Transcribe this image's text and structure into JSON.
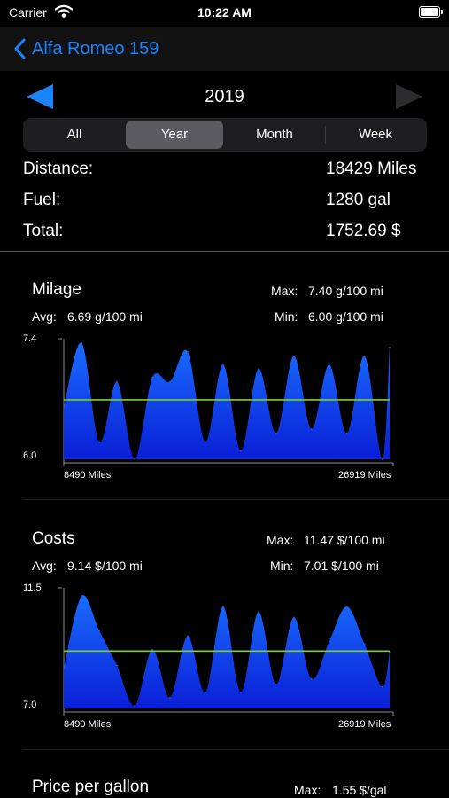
{
  "status_bar": {
    "carrier": "Carrier",
    "time": "10:22 AM"
  },
  "nav": {
    "back_label": "Alfa Romeo 159"
  },
  "year": "2019",
  "segments": {
    "all": "All",
    "year": "Year",
    "month": "Month",
    "week": "Week",
    "selected": "Year"
  },
  "summary": [
    {
      "label": "Distance:",
      "value": "18429 Miles"
    },
    {
      "label": "Fuel:",
      "value": "1280 gal"
    },
    {
      "label": "Total:",
      "value": "1752.69 $"
    }
  ],
  "colors": {
    "accent": "#1a84ff",
    "fill_top": "#1a6cff",
    "fill_bottom": "#0a1fd6",
    "avg_line": "#7fd12a"
  },
  "icons": {
    "back": "chevron-left-icon",
    "prev": "triangle-left-icon",
    "next": "triangle-right-icon"
  },
  "milage": {
    "title": "Milage",
    "max_label": "Max:",
    "max_value": "7.40 g/100 mi",
    "avg_label": "Avg:",
    "avg_value": "6.69 g/100 mi",
    "min_label": "Min:",
    "min_value": "6.00 g/100 mi",
    "y_top": "7.4",
    "y_bottom": "6.0",
    "x_start": "8490 Miles",
    "x_end": "26919 Miles"
  },
  "costs": {
    "title": "Costs",
    "max_label": "Max:",
    "max_value": "11.47 $/100 mi",
    "avg_label": "Avg:",
    "avg_value": "9.14 $/100 mi",
    "min_label": "Min:",
    "min_value": "7.01 $/100 mi",
    "y_top": "11.5",
    "y_bottom": "7.0",
    "x_start": "8490 Miles",
    "x_end": "26919 Miles"
  },
  "price": {
    "title": "Price per gallon",
    "max_label": "Max:",
    "max_value": "1.55 $/gal"
  },
  "chart_data": [
    {
      "type": "area",
      "x": [
        8490,
        9500,
        10500,
        11500,
        12500,
        13500,
        14500,
        15500,
        16500,
        17500,
        18500,
        19500,
        20500,
        21500,
        22500,
        23500,
        24500,
        25500,
        26500,
        26919
      ],
      "values": [
        6.6,
        7.35,
        6.2,
        6.9,
        6.0,
        6.95,
        6.9,
        7.25,
        6.2,
        7.1,
        6.1,
        7.05,
        6.3,
        7.2,
        6.35,
        7.1,
        6.3,
        7.2,
        6.0,
        7.3
      ],
      "avg": 6.69,
      "ylim": [
        6.0,
        7.4
      ]
    },
    {
      "type": "area",
      "x": [
        8490,
        9500,
        10500,
        11500,
        12500,
        13500,
        14500,
        15500,
        16500,
        17500,
        18500,
        19500,
        20500,
        21500,
        22500,
        23500,
        24500,
        25500,
        26500,
        26919
      ],
      "values": [
        8.5,
        11.2,
        9.9,
        8.6,
        7.1,
        9.2,
        7.4,
        9.7,
        7.6,
        10.8,
        7.6,
        10.6,
        7.9,
        10.4,
        8.1,
        9.5,
        10.8,
        9.4,
        7.8,
        9.1
      ],
      "avg": 9.14,
      "ylim": [
        7.0,
        11.5
      ]
    }
  ]
}
